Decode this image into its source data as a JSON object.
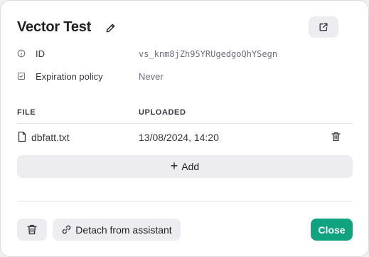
{
  "header": {
    "title": "Vector Test",
    "edit_icon": "pencil-icon",
    "open_icon": "external-link-icon"
  },
  "meta": {
    "id_label": "ID",
    "id_value": "vs_knm8jZh95YRUgedgoQhYSegn",
    "expiration_label": "Expiration policy",
    "expiration_value": "Never"
  },
  "files": {
    "col_file": "FILE",
    "col_uploaded": "UPLOADED",
    "rows": [
      {
        "name": "dbfatt.txt",
        "uploaded": "13/08/2024, 14:20"
      }
    ],
    "add_label": "Add"
  },
  "footer": {
    "detach_label": "Detach from assistant",
    "close_label": "Close"
  },
  "colors": {
    "accent": "#10a37f",
    "button_bg": "#ececf1"
  }
}
